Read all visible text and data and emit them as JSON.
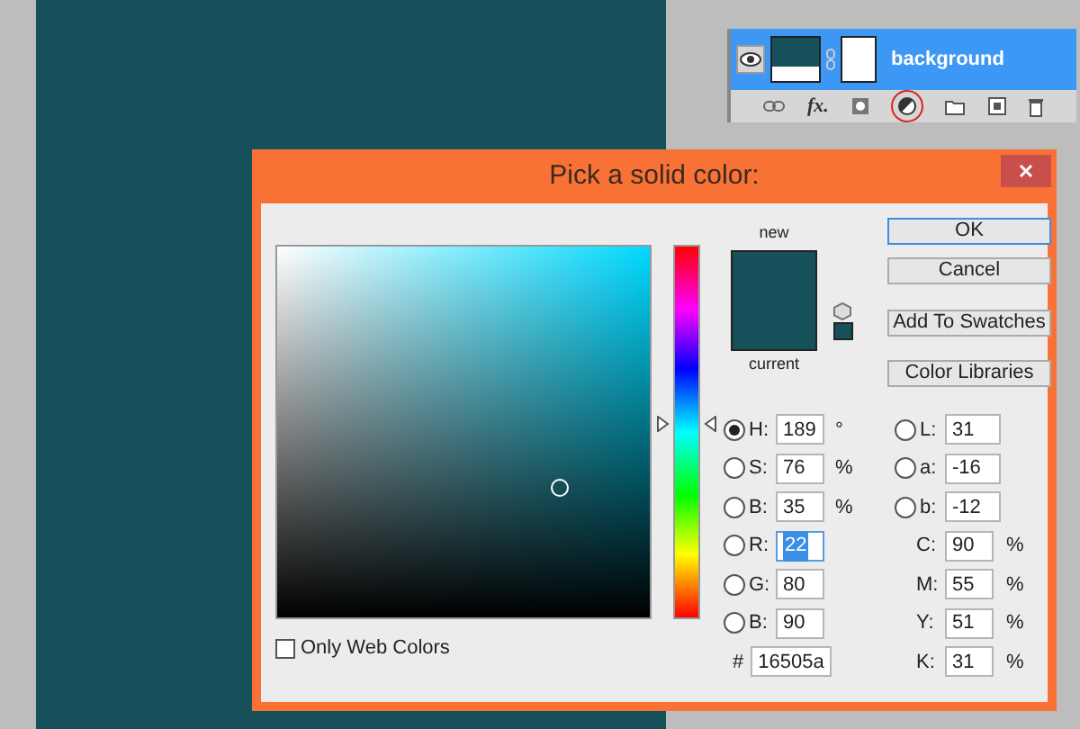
{
  "layers_panel": {
    "layers": [
      {
        "name": "background",
        "selected": true,
        "visible": true
      }
    ],
    "fx_label": "fx."
  },
  "dialog": {
    "title": "Pick a solid color:",
    "hue_slider": {
      "level": 0.525
    },
    "swatch_labels": {
      "new": "new",
      "current": "current"
    },
    "buttons": [
      {
        "label": "OK",
        "default": true
      },
      {
        "label": "Cancel",
        "default": false
      },
      {
        "label": "Add To Swatches",
        "default": false
      },
      {
        "label": "Color Libraries",
        "default": false
      }
    ],
    "hsb": [
      {
        "label": "H:",
        "value": "189",
        "unit": "°",
        "selected": true,
        "highlighted": false
      },
      {
        "label": "S:",
        "value": "76",
        "unit": "%",
        "selected": false,
        "highlighted": false
      },
      {
        "label": "B:",
        "value": "35",
        "unit": "%",
        "selected": false,
        "highlighted": false
      }
    ],
    "rgb": [
      {
        "label": "R:",
        "value": "22",
        "selected": false,
        "highlighted": true
      },
      {
        "label": "G:",
        "value": "80",
        "selected": false,
        "highlighted": false
      },
      {
        "label": "B:",
        "value": "90",
        "selected": false,
        "highlighted": false
      }
    ],
    "hex": {
      "label": "#",
      "value": "16505a"
    },
    "lab": [
      {
        "label": "L:",
        "value": "31",
        "selected": false
      },
      {
        "label": "a:",
        "value": "-16",
        "selected": false
      },
      {
        "label": "b:",
        "value": "-12",
        "selected": false
      }
    ],
    "cmyk": [
      {
        "label": "C:",
        "value": "90",
        "unit": "%"
      },
      {
        "label": "M:",
        "value": "55",
        "unit": "%"
      },
      {
        "label": "Y:",
        "value": "51",
        "unit": "%"
      },
      {
        "label": "K:",
        "value": "31",
        "unit": "%"
      }
    ],
    "only_web_colors": {
      "label": "Only Web Colors",
      "checked": false
    }
  }
}
